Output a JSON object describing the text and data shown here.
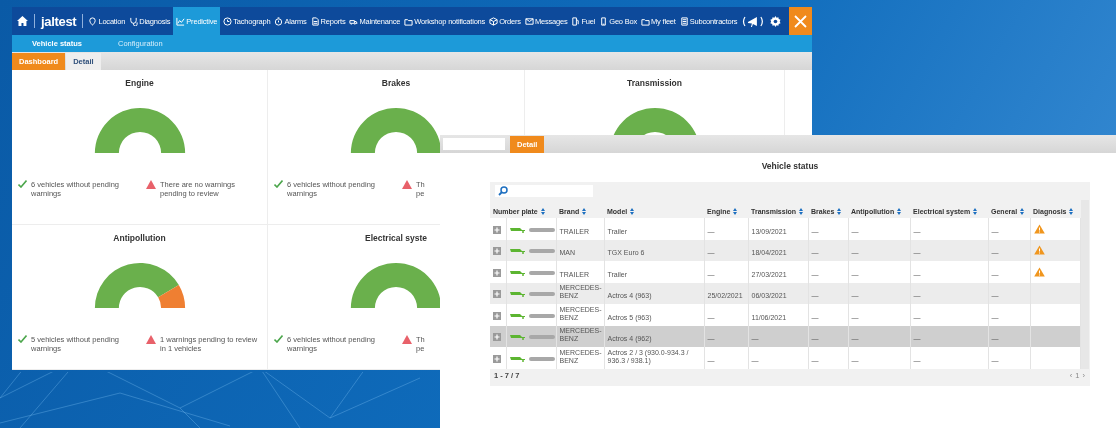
{
  "nav": {
    "logo": "jaltest",
    "items": [
      {
        "label": "Location",
        "selected": false
      },
      {
        "label": "Diagnosis",
        "selected": false
      },
      {
        "label": "Predictive",
        "selected": true
      },
      {
        "label": "Tachograph",
        "selected": false
      },
      {
        "label": "Alarms",
        "selected": false
      },
      {
        "label": "Reports",
        "selected": false
      },
      {
        "label": "Maintenance",
        "selected": false
      },
      {
        "label": "Workshop notifications",
        "selected": false
      },
      {
        "label": "Orders",
        "selected": false
      },
      {
        "label": "Messages",
        "selected": false
      },
      {
        "label": "Fuel",
        "selected": false
      },
      {
        "label": "Geo Box",
        "selected": false
      },
      {
        "label": "My fleet",
        "selected": false
      },
      {
        "label": "Subcontractors",
        "selected": false
      }
    ]
  },
  "subtabs": [
    {
      "label": "Vehicle status",
      "selected": true
    },
    {
      "label": "Configuration",
      "selected": false
    }
  ],
  "view_tabs": [
    {
      "label": "Dashboard",
      "selected": true
    },
    {
      "label": "Detail",
      "selected": false
    }
  ],
  "cards": [
    {
      "title": "Engine",
      "has_warnings": false,
      "ok_lines": [
        "6 vehicles without pending",
        "warnings"
      ],
      "warning_lines": [
        "There are no warnings",
        "pending to review"
      ]
    },
    {
      "title": "Brakes",
      "has_warnings": false,
      "ok_lines": [
        "6 vehicles without pending",
        "warnings"
      ],
      "warning_lines": [
        "Th",
        "pe"
      ]
    },
    {
      "title": "Transmission",
      "has_warnings": false
    },
    {
      "title": "Antipollution",
      "has_warnings": true,
      "ok_lines": [
        "5 vehicles without pending",
        "warnings"
      ],
      "warning_lines": [
        "1 warnings pending to review",
        "in 1 vehicles"
      ]
    },
    {
      "title": "Electrical syste",
      "has_warnings": false,
      "ok_lines": [
        "6 vehicles without pending",
        "warnings"
      ],
      "warning_lines": [
        "Th",
        "pe"
      ]
    }
  ],
  "detail": {
    "tabs": [
      {
        "label": "Detail",
        "selected": true
      }
    ],
    "title": "Vehicle status",
    "columns": [
      "Number plate",
      "Brand",
      "Model",
      "Engine",
      "Transmission",
      "Brakes",
      "Antipollution",
      "Electrical system",
      "General",
      "Diagnosis"
    ],
    "rows": [
      {
        "brand": "TRAILER",
        "model": "Trailer",
        "values": [
          "—",
          "13/09/2021",
          "—",
          "—",
          "—",
          "—"
        ],
        "warning": true,
        "selected": false
      },
      {
        "brand": "MAN",
        "model": "TGX Euro 6",
        "values": [
          "—",
          "18/04/2021",
          "—",
          "—",
          "—",
          "—"
        ],
        "warning": true,
        "selected": false
      },
      {
        "brand": "TRAILER",
        "model": "Trailer",
        "values": [
          "—",
          "27/03/2021",
          "—",
          "—",
          "—",
          "—"
        ],
        "warning": true,
        "selected": false
      },
      {
        "brand": "MERCEDES-BENZ",
        "model": "Actros 4 (963)",
        "values": [
          "25/02/2021",
          "06/03/2021",
          "—",
          "—",
          "—",
          "—"
        ],
        "warning": false,
        "selected": false
      },
      {
        "brand": "MERCEDES-BENZ",
        "model": "Actros 5 (963)",
        "values": [
          "—",
          "11/06/2021",
          "—",
          "—",
          "—",
          "—"
        ],
        "warning": false,
        "selected": false
      },
      {
        "brand": "MERCEDES-BENZ",
        "model": "Actros 4 (962)",
        "values": [
          "—",
          "—",
          "—",
          "—",
          "—",
          "—"
        ],
        "warning": false,
        "selected": true
      },
      {
        "brand": "MERCEDES-BENZ",
        "model": "Actros 2 / 3 (930.0-934.3 / 936.3 / 938.1)",
        "values": [
          "—",
          "—",
          "—",
          "—",
          "—",
          "—"
        ],
        "warning": false,
        "selected": false
      }
    ],
    "footer": "1 - 7 / 7",
    "pager": {
      "prev": "‹",
      "page": "1",
      "next": "›"
    }
  }
}
